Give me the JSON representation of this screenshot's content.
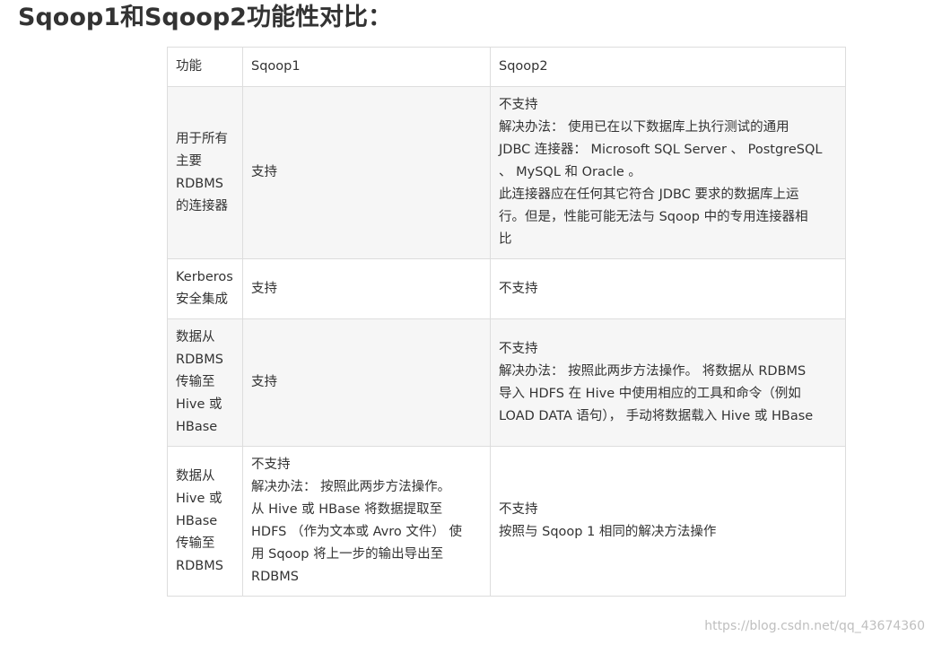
{
  "title": "Sqoop1和Sqoop2功能性对比：",
  "table": {
    "headers": [
      "功能",
      "Sqoop1",
      "Sqoop2"
    ],
    "rows": [
      {
        "feature": [
          "用于所有",
          "主要",
          "RDBMS",
          "的连接器"
        ],
        "sqoop1": [
          "支持"
        ],
        "sqoop2": [
          "不支持",
          "解决办法： 使用已在以下数据库上执行测试的通用",
          "JDBC 连接器： Microsoft SQL Server 、 PostgreSQL",
          "、 MySQL 和 Oracle 。",
          "此连接器应在任何其它符合 JDBC 要求的数据库上运",
          "行。但是，性能可能无法与 Sqoop 中的专用连接器相",
          "比"
        ]
      },
      {
        "feature": [
          "Kerberos",
          "安全集成"
        ],
        "sqoop1": [
          "支持"
        ],
        "sqoop2": [
          "不支持"
        ]
      },
      {
        "feature": [
          "数据从",
          "RDBMS",
          "传输至",
          "Hive 或",
          "HBase"
        ],
        "sqoop1": [
          "支持"
        ],
        "sqoop2": [
          "不支持",
          "解决办法： 按照此两步方法操作。 将数据从 RDBMS",
          "导入 HDFS 在 Hive 中使用相应的工具和命令（例如",
          "LOAD DATA 语句）， 手动将数据载入 Hive 或 HBase"
        ]
      },
      {
        "feature": [
          "数据从",
          "Hive 或",
          "HBase",
          "传输至",
          "RDBMS"
        ],
        "sqoop1": [
          "不支持",
          "解决办法： 按照此两步方法操作。",
          "从 Hive 或 HBase 将数据提取至",
          "HDFS （作为文本或 Avro 文件） 使",
          "用 Sqoop 将上一步的输出导出至",
          "RDBMS"
        ],
        "sqoop2": [
          "不支持",
          "按照与 Sqoop 1 相同的解决方法操作"
        ]
      }
    ]
  },
  "watermark": "https://blog.csdn.net/qq_43674360"
}
